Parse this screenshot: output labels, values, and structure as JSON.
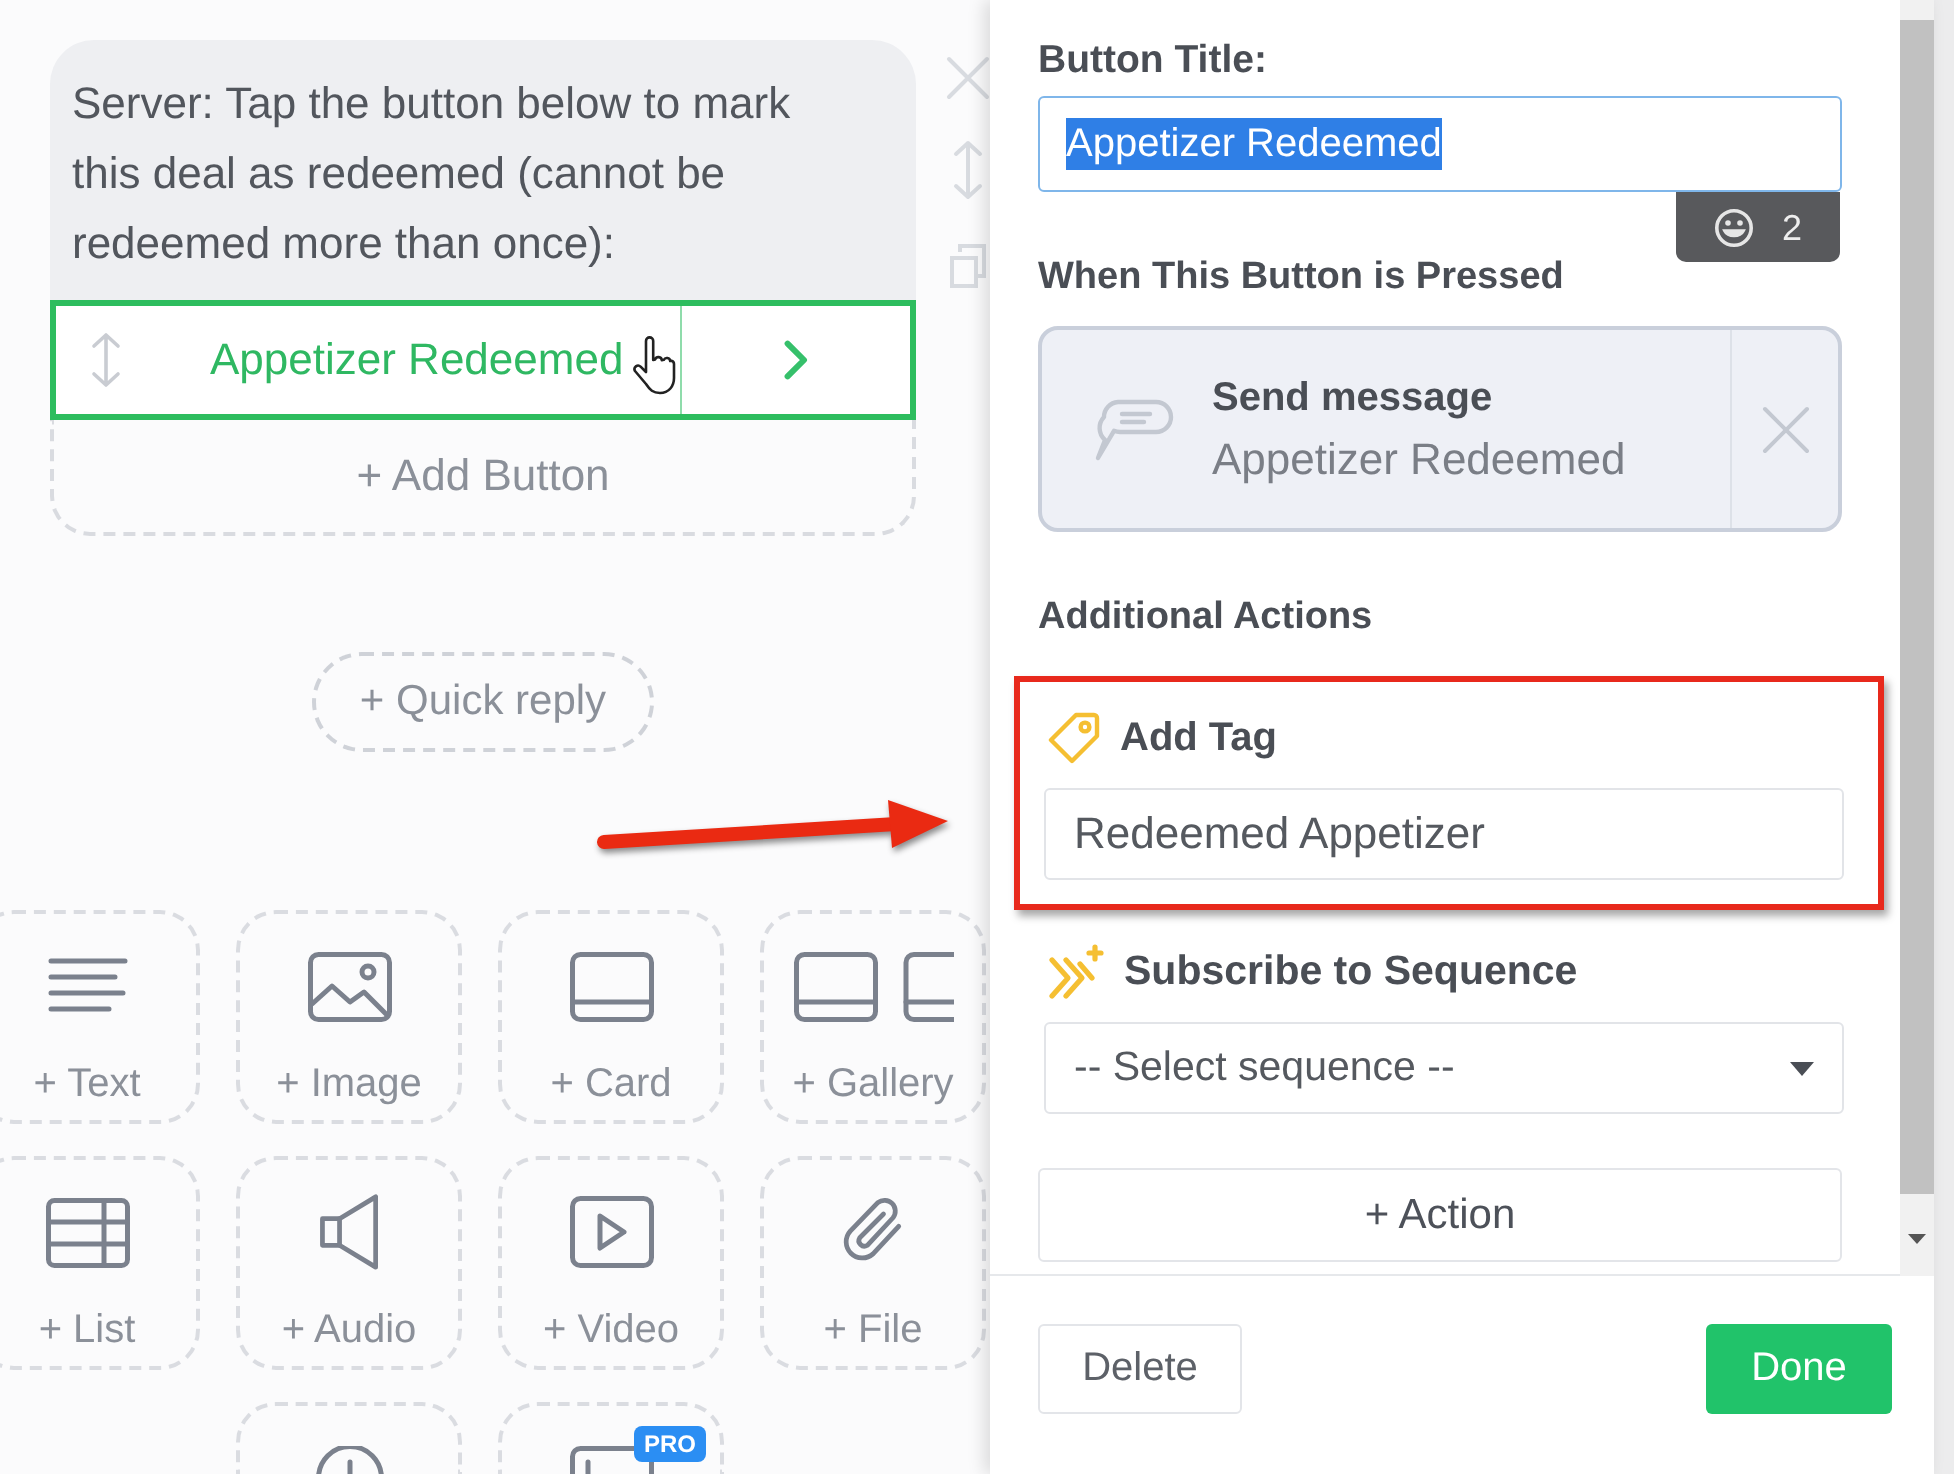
{
  "canvas": {
    "message_card": {
      "text": "Server: Tap the button below to mark this deal as redeemed (cannot be redeemed more than once):",
      "buttons": [
        {
          "title": "Appetizer Redeemed",
          "selected": true
        }
      ],
      "add_button": "+ Add Button"
    },
    "quick_reply": "+ Quick reply",
    "blocks": [
      {
        "kind": "text",
        "label": "+ Text"
      },
      {
        "kind": "image",
        "label": "+ Image"
      },
      {
        "kind": "card",
        "label": "+ Card"
      },
      {
        "kind": "gallery",
        "label": "+ Gallery"
      },
      {
        "kind": "list",
        "label": "+ List"
      },
      {
        "kind": "audio",
        "label": "+ Audio"
      },
      {
        "kind": "video",
        "label": "+ Video"
      },
      {
        "kind": "file",
        "label": "+ File"
      },
      {
        "kind": "timer"
      },
      {
        "kind": "frame",
        "badge": "PRO"
      }
    ]
  },
  "editor": {
    "title": {
      "label": "Button Title:",
      "value": "Appetizer Redeemed",
      "text_selected": true,
      "emoji_count": "2"
    },
    "pressed": {
      "label": "When This Button is Pressed",
      "action": {
        "kind": "send_message",
        "title": "Send message",
        "detail": "Appetizer Redeemed"
      }
    },
    "additional": {
      "label": "Additional Actions",
      "actions": [
        {
          "kind": "tag",
          "title": "Add Tag",
          "value": "Redeemed Appetizer",
          "highlighted": true
        },
        {
          "kind": "sequence",
          "title": "Subscribe to Sequence",
          "value": "-- Select sequence --",
          "highlighted": false
        }
      ]
    },
    "add_action": "+ Action",
    "footer": {
      "delete": "Delete",
      "done": "Done"
    }
  }
}
